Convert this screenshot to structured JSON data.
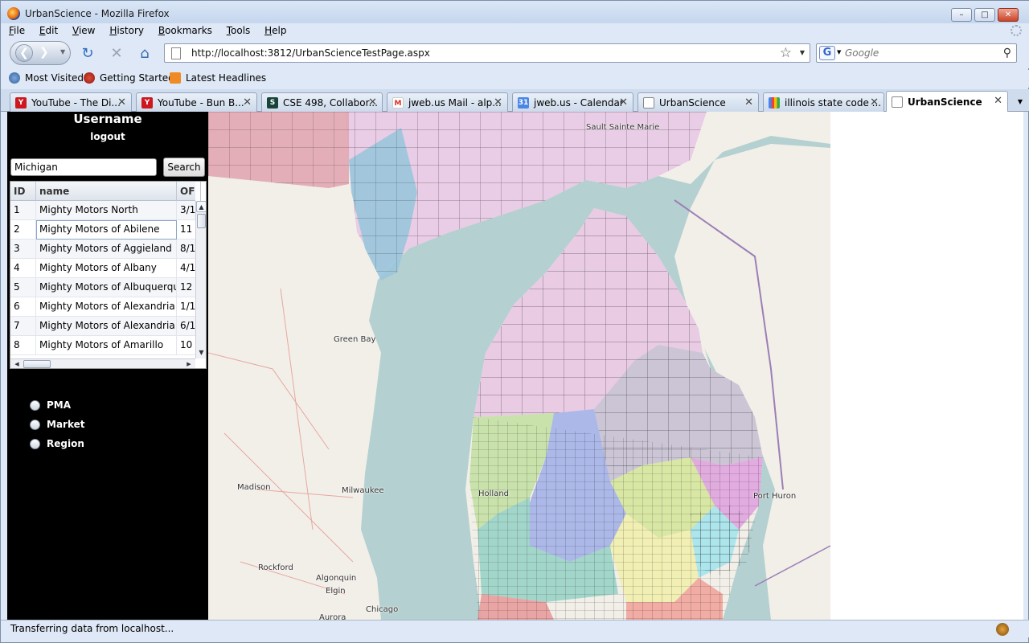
{
  "window": {
    "title": "UrbanScience - Mozilla Firefox",
    "controls": [
      "minimize",
      "maximize",
      "close"
    ]
  },
  "menu": {
    "items": [
      {
        "label": "File",
        "accel": "F",
        "rest": "ile"
      },
      {
        "label": "Edit",
        "accel": "E",
        "rest": "dit"
      },
      {
        "label": "View",
        "accel": "V",
        "rest": "iew"
      },
      {
        "label": "History",
        "accel": "H",
        "rest": "istory"
      },
      {
        "label": "Bookmarks",
        "accel": "B",
        "rest": "ookmarks"
      },
      {
        "label": "Tools",
        "accel": "T",
        "rest": "ools"
      },
      {
        "label": "Help",
        "accel": "H",
        "rest": "elp"
      }
    ]
  },
  "nav": {
    "url": "http://localhost:3812/UrbanScienceTestPage.aspx",
    "search_placeholder": "Google",
    "icons": [
      "back-icon",
      "forward-icon",
      "reload-icon",
      "stop-icon",
      "home-icon",
      "star-icon",
      "search-engine-icon",
      "magnifier-icon"
    ]
  },
  "bookmarks": [
    {
      "label": "Most Visited",
      "icon": "most-visited-icon"
    },
    {
      "label": "Getting Started",
      "icon": "getting-started-icon"
    },
    {
      "label": "Latest Headlines",
      "icon": "rss-icon"
    }
  ],
  "tabs": [
    {
      "label": "YouTube - The Di...",
      "icon": "youtube-icon",
      "color": "#cc181e"
    },
    {
      "label": "YouTube - Bun B...",
      "icon": "youtube-icon",
      "color": "#cc181e"
    },
    {
      "label": "CSE 498, Collabor...",
      "icon": "msu-icon",
      "color": "#18453b"
    },
    {
      "label": "jweb.us Mail - alp...",
      "icon": "gmail-icon",
      "color": "#d93025"
    },
    {
      "label": "jweb.us - Calendar",
      "icon": "calendar-icon",
      "color": "#4a86e8"
    },
    {
      "label": "UrbanScience",
      "icon": "page-icon",
      "color": "#ffffff"
    },
    {
      "label": "illinois state code ...",
      "icon": "google-icon",
      "color": "#4285f4"
    },
    {
      "label": "UrbanScience",
      "icon": "page-icon",
      "color": "#ffffff",
      "active": true
    }
  ],
  "sidebar": {
    "username": "Username",
    "logout": "logout",
    "search_value": "Michigan",
    "search_button": "Search",
    "grid": {
      "columns": [
        "ID",
        "name",
        "OF"
      ],
      "rows": [
        {
          "id": "1",
          "name": "Mighty Motors North",
          "of": "3/1"
        },
        {
          "id": "2",
          "name": "Mighty Motors of Abilene",
          "of": "11"
        },
        {
          "id": "3",
          "name": "Mighty Motors of Aggieland",
          "of": "8/1"
        },
        {
          "id": "4",
          "name": "Mighty Motors of Albany",
          "of": "4/1"
        },
        {
          "id": "5",
          "name": "Mighty Motors of Albuquerque",
          "of": "12"
        },
        {
          "id": "6",
          "name": "Mighty Motors of Alexandria",
          "of": "1/1"
        },
        {
          "id": "7",
          "name": "Mighty Motors of Alexandria",
          "of": "6/1"
        },
        {
          "id": "8",
          "name": "Mighty Motors of Amarillo",
          "of": "10"
        }
      ],
      "selected_row": 2
    },
    "radios": [
      {
        "label": "PMA"
      },
      {
        "label": "Market"
      },
      {
        "label": "Region"
      }
    ]
  },
  "map": {
    "water_color": "#b5d0d0",
    "land_color": "#f2efe9",
    "labels": [
      "Sault Sainte Marie",
      "Green Bay",
      "Madison",
      "Milwaukee",
      "Rockford",
      "Algonquin",
      "Elgin",
      "Chicago",
      "Aurora",
      "Holland",
      "Port Huron"
    ]
  },
  "status": {
    "text": "Transferring data from localhost..."
  }
}
